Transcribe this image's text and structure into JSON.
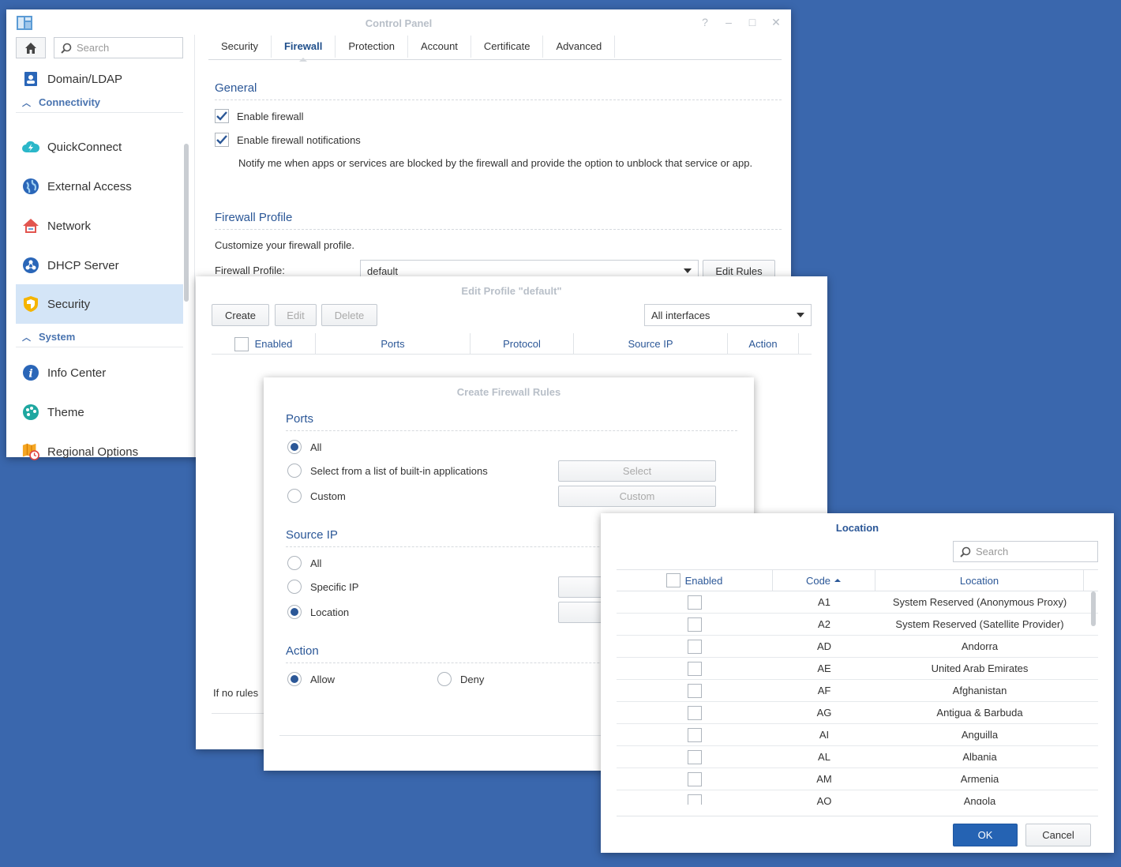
{
  "control_panel": {
    "title": "Control Panel",
    "window_controls": [
      "?",
      "–",
      "□",
      "✕"
    ],
    "sidebar": {
      "search_placeholder": "Search",
      "items": [
        {
          "label": "Domain/LDAP",
          "icon": "domain-ldap-icon"
        },
        {
          "label": "QuickConnect",
          "icon": "quickconnect-icon"
        },
        {
          "label": "External Access",
          "icon": "external-access-icon"
        },
        {
          "label": "Network",
          "icon": "network-icon"
        },
        {
          "label": "DHCP Server",
          "icon": "dhcp-server-icon"
        },
        {
          "label": "Security",
          "icon": "security-shield-icon"
        },
        {
          "label": "Info Center",
          "icon": "info-center-icon"
        },
        {
          "label": "Theme",
          "icon": "theme-palette-icon"
        },
        {
          "label": "Regional Options",
          "icon": "regional-options-icon"
        }
      ],
      "categories": [
        "Connectivity",
        "System"
      ]
    },
    "tabs": [
      "Security",
      "Firewall",
      "Protection",
      "Account",
      "Certificate",
      "Advanced"
    ],
    "active_tab": "Firewall",
    "general": {
      "heading": "General",
      "enable_firewall": "Enable firewall",
      "enable_notifications": "Enable firewall notifications",
      "notify_text": "Notify me when apps or services are blocked by the firewall and provide the option to unblock that service or app."
    },
    "profile": {
      "heading": "Firewall Profile",
      "desc": "Customize your firewall profile.",
      "label": "Firewall Profile:",
      "value": "default",
      "edit_rules": "Edit Rules"
    }
  },
  "edit_profile": {
    "title": "Edit Profile \"default\"",
    "create": "Create",
    "edit": "Edit",
    "delete": "Delete",
    "interfaces": "All interfaces",
    "columns": [
      "Enabled",
      "Ports",
      "Protocol",
      "Source IP",
      "Action"
    ],
    "footer_text": "If no rules"
  },
  "create_rules": {
    "title": "Create Firewall Rules",
    "ports_heading": "Ports",
    "ports_all": "All",
    "ports_builtin": "Select from a list of built-in applications",
    "ports_custom": "Custom",
    "select_btn": "Select",
    "custom_btn": "Custom",
    "source_heading": "Source IP",
    "source_all": "All",
    "source_specific": "Specific IP",
    "source_location": "Location",
    "action_heading": "Action",
    "action_allow": "Allow",
    "action_deny": "Deny"
  },
  "location": {
    "title": "Location",
    "search_placeholder": "Search",
    "columns": {
      "enabled": "Enabled",
      "code": "Code",
      "location": "Location"
    },
    "rows": [
      {
        "code": "A1",
        "name": "System Reserved (Anonymous Proxy)"
      },
      {
        "code": "A2",
        "name": "System Reserved (Satellite Provider)"
      },
      {
        "code": "AD",
        "name": "Andorra"
      },
      {
        "code": "AE",
        "name": "United Arab Emirates"
      },
      {
        "code": "AF",
        "name": "Afghanistan"
      },
      {
        "code": "AG",
        "name": "Antigua & Barbuda"
      },
      {
        "code": "AI",
        "name": "Anguilla"
      },
      {
        "code": "AL",
        "name": "Albania"
      },
      {
        "code": "AM",
        "name": "Armenia"
      },
      {
        "code": "AO",
        "name": "Angola"
      }
    ],
    "ok": "OK",
    "cancel": "Cancel"
  }
}
